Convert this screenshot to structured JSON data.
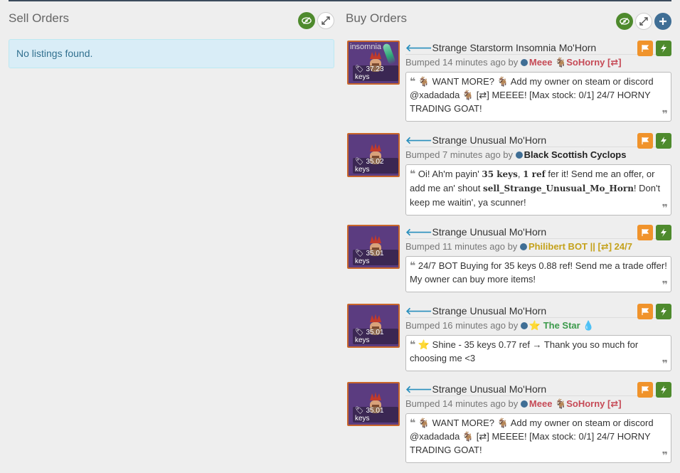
{
  "sell": {
    "title": "Sell Orders",
    "empty_text": "No listings found."
  },
  "buy": {
    "title": "Buy Orders",
    "listings": [
      {
        "item": "Strange Starstorm Insomnia Mo'Horn",
        "effect": "insomnia",
        "price": "37.23 keys",
        "bumped": "Bumped 14 minutes ago by",
        "user": "Meee 🐐SoHorny [⇄]",
        "message": "🐐 WANT MORE? 🐐 Add my owner on steam or discord @xadadada 🐐 [⇄] MEEEE! [Max stock: 0/1] 24/7 HORNY TRADING GOAT!"
      },
      {
        "item": "Strange Unusual Mo'Horn",
        "price": "35.02 keys",
        "bumped": "Bumped 7 minutes ago by",
        "user": "Black Scottish Cyclops",
        "message_parts": [
          "Oi! Ah'm payin' ",
          "35 keys",
          ", ",
          "1 ref",
          " fer it! Send me an offer, or add me an' shout ",
          "sell_Strange_Unusual_Mo_Horn",
          "! Don't keep me waitin', ya scunner!"
        ]
      },
      {
        "item": "Strange Unusual Mo'Horn",
        "price": "35.01 keys",
        "bumped": "Bumped 11 minutes ago by",
        "user": "Philibert BOT || [⇄] 24/7",
        "message": "24/7 BOT Buying for 35 keys 0.88 ref! Send me a trade offer! My owner can buy more items!"
      },
      {
        "item": "Strange Unusual Mo'Horn",
        "price": "35.01 keys",
        "bumped": "Bumped 16 minutes ago by",
        "user": "⭐ The Star 💧",
        "message": "⭐ Shine - 35 keys 0.77 ref → Thank you so much for choosing me <3"
      },
      {
        "item": "Strange Unusual Mo'Horn",
        "price": "35.01 keys",
        "bumped": "Bumped 14 minutes ago by",
        "user": "Meee 🐐SoHorny [⇄]",
        "message": "🐐 WANT MORE? 🐐 Add my owner on steam or discord @xadadada 🐐 [⇄] MEEEE! [Max stock: 0/1] 24/7 HORNY TRADING GOAT!"
      }
    ]
  },
  "colors": {
    "orange": "#f0932b",
    "green": "#4e8a2d",
    "blue_link": "#2a8fbd",
    "alert_bg": "#d9edf7"
  }
}
